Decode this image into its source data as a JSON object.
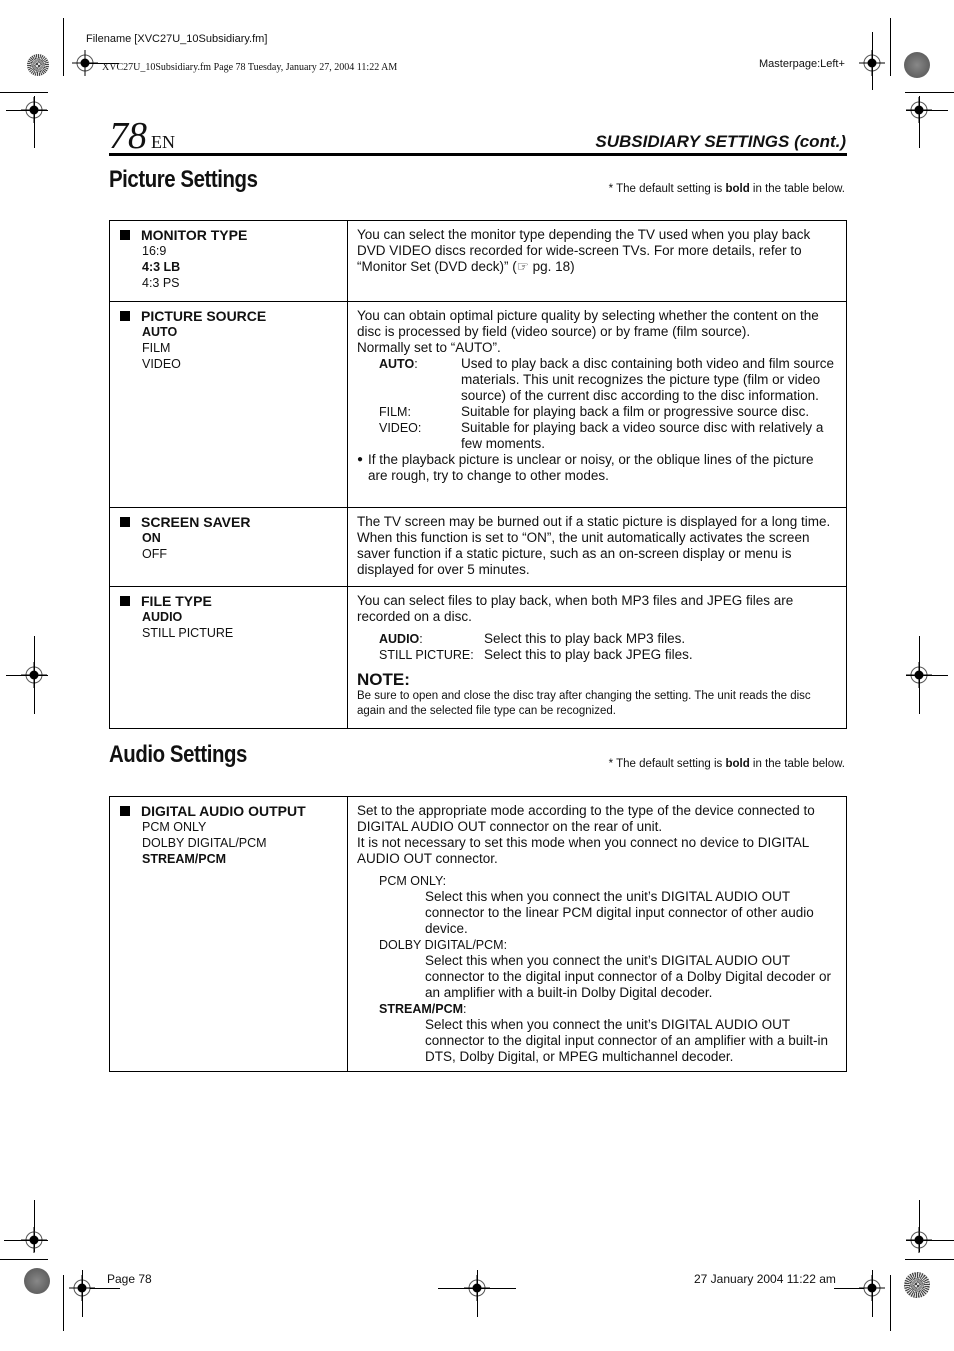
{
  "printer_slug": {
    "filename": "Filename [XVC27U_10Subsidiary.fm]",
    "file_info": "XVC27U_10Subsidiary.fm  Page 78  Tuesday, January 27, 2004  11:22 AM",
    "masterpage": "Masterpage:Left+"
  },
  "header": {
    "page_number": "78",
    "language": "EN",
    "running_head": "SUBSIDIARY SETTINGS (cont.)"
  },
  "picture_settings": {
    "title": "Picture Settings",
    "default_note_prefix": "* The default setting is ",
    "default_note_bold": "bold",
    "default_note_suffix": " in the table below.",
    "rows": [
      {
        "name": "MONITOR TYPE",
        "options": [
          {
            "label": "16:9",
            "default": false
          },
          {
            "label": "4:3 LB",
            "default": true
          },
          {
            "label": "4:3 PS",
            "default": false
          }
        ],
        "description": "You can select the monitor type depending the TV used when you play back DVD VIDEO discs recorded for wide-screen TVs. For more details, refer to “Monitor Set (DVD deck)” (☞ pg. 18)"
      },
      {
        "name": "PICTURE SOURCE",
        "options": [
          {
            "label": "AUTO",
            "default": true
          },
          {
            "label": "FILM",
            "default": false
          },
          {
            "label": "VIDEO",
            "default": false
          }
        ],
        "description": "You can obtain optimal picture quality by selecting whether the content on the disc is processed by field (video source) or by frame (film source).",
        "normally": "Normally set to “AUTO”.",
        "definitions": [
          {
            "term": "AUTO",
            "bold": true,
            "text": "Used to play back a disc containing both video and film source materials. This unit recognizes the picture type (film or video source) of the current disc according to the disc information."
          },
          {
            "term": "FILM:",
            "bold": false,
            "text": "Suitable for playing back a film or progressive source disc."
          },
          {
            "term": "VIDEO:",
            "bold": false,
            "text": "Suitable for playing back a video source disc with relatively a few moments."
          }
        ],
        "bullet": "If the playback picture is unclear or noisy, or the oblique lines of the picture are rough, try to change to other modes."
      },
      {
        "name": "SCREEN SAVER",
        "options": [
          {
            "label": "ON",
            "default": true
          },
          {
            "label": "OFF",
            "default": false
          }
        ],
        "description": "The TV screen may be burned out if a static picture is displayed for a long time. When this function is set to “ON”, the unit automatically activates the screen saver function if a static picture, such as an on-screen display or menu is displayed for over 5 minutes."
      },
      {
        "name": "FILE TYPE",
        "options": [
          {
            "label": "AUDIO",
            "default": true
          },
          {
            "label": "STILL PICTURE",
            "default": false
          }
        ],
        "description": "You can select files to play back, when both MP3 files and JPEG files are recorded on a disc.",
        "definitions": [
          {
            "term": "AUDIO",
            "bold": true,
            "text": "Select this to play back MP3 files."
          },
          {
            "term": "STILL PICTURE:",
            "bold": false,
            "text": "Select this to play back JPEG files."
          }
        ],
        "note_title": "NOTE:",
        "note_text": "Be sure to open and close the disc tray after changing the setting. The unit reads the disc again and the selected file type can be recognized."
      }
    ]
  },
  "audio_settings": {
    "title": "Audio Settings",
    "default_note_prefix": "* The default setting is ",
    "default_note_bold": "bold",
    "default_note_suffix": " in the table below.",
    "rows": [
      {
        "name": "DIGITAL AUDIO OUTPUT",
        "options": [
          {
            "label": "PCM ONLY",
            "default": false
          },
          {
            "label": "DOLBY DIGITAL/PCM",
            "default": false
          },
          {
            "label": "STREAM/PCM",
            "default": true
          }
        ],
        "description1": "Set to the appropriate mode according to the type of the device connected to DIGITAL AUDIO OUT connector on the rear of unit.",
        "description2": "It is not necessary to set this mode when you connect no device to DIGITAL AUDIO OUT connector.",
        "definitions": [
          {
            "term": "PCM ONLY:",
            "bold": false,
            "text": "Select this when you connect the unit’s DIGITAL AUDIO OUT connector to the linear PCM digital input connector of other audio device."
          },
          {
            "term": "DOLBY DIGITAL/PCM:",
            "bold": false,
            "text": "Select this when you connect the unit’s DIGITAL AUDIO OUT connector to the digital input connector of a Dolby Digital decoder or an amplifier with a built-in Dolby Digital decoder."
          },
          {
            "term": "STREAM/PCM",
            "bold": true,
            "text": "Select this when you connect the unit’s DIGITAL AUDIO OUT connector to the digital input connector of an amplifier with a built-in DTS, Dolby Digital, or MPEG multichannel decoder."
          }
        ]
      }
    ]
  },
  "footer": {
    "page_label": "Page 78",
    "timestamp": "27 January 2004 11:22 am"
  }
}
